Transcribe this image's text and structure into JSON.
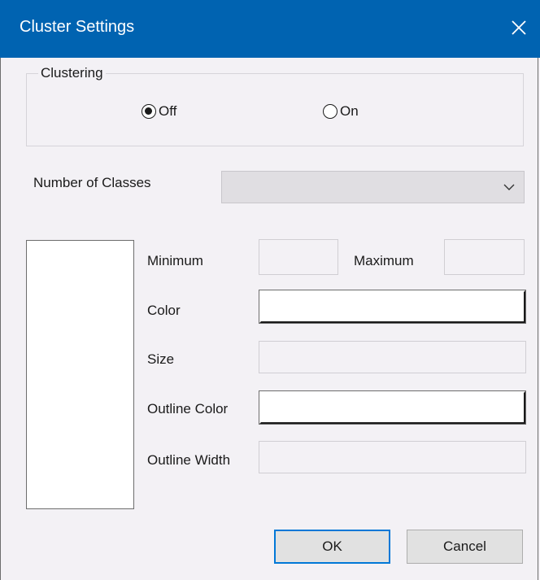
{
  "window": {
    "title": "Cluster Settings"
  },
  "clustering": {
    "legend": "Clustering",
    "options": [
      {
        "label": "Off",
        "checked": true
      },
      {
        "label": "On",
        "checked": false
      }
    ]
  },
  "classes": {
    "label": "Number of Classes",
    "value": ""
  },
  "fields": {
    "minimum_label": "Minimum",
    "maximum_label": "Maximum",
    "color_label": "Color",
    "size_label": "Size",
    "outline_color_label": "Outline Color",
    "outline_width_label": "Outline Width",
    "minimum_value": "",
    "maximum_value": "",
    "size_value": "",
    "outline_width_value": ""
  },
  "buttons": {
    "ok": "OK",
    "cancel": "Cancel"
  },
  "colors": {
    "titlebar": "#0063b1",
    "background": "#f3f1f5",
    "default_button_border": "#0078d7"
  },
  "icons": {
    "close": "close-icon",
    "dropdown": "chevron-down-icon"
  }
}
